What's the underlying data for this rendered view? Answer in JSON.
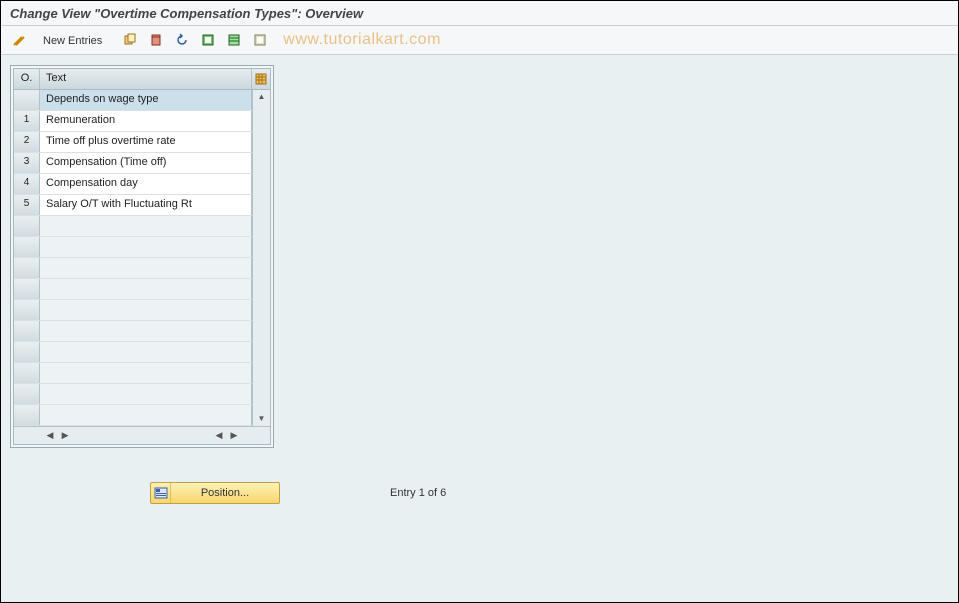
{
  "header": {
    "title": "Change View \"Overtime Compensation Types\": Overview"
  },
  "toolbar": {
    "new_entries_label": "New Entries"
  },
  "watermark": "www.tutorialkart.com",
  "table": {
    "columns": {
      "o": "O.",
      "text": "Text"
    },
    "rows": [
      {
        "o": "",
        "text": "Depends on wage type",
        "selected": true
      },
      {
        "o": "1",
        "text": "Remuneration"
      },
      {
        "o": "2",
        "text": "Time off plus overtime rate"
      },
      {
        "o": "3",
        "text": "Compensation (Time off)"
      },
      {
        "o": "4",
        "text": "Compensation day"
      },
      {
        "o": "5",
        "text": "Salary O/T with Fluctuating Rt"
      }
    ],
    "empty_rows": 10
  },
  "footer": {
    "position_label": "Position...",
    "entry_text": "Entry 1 of 6"
  }
}
